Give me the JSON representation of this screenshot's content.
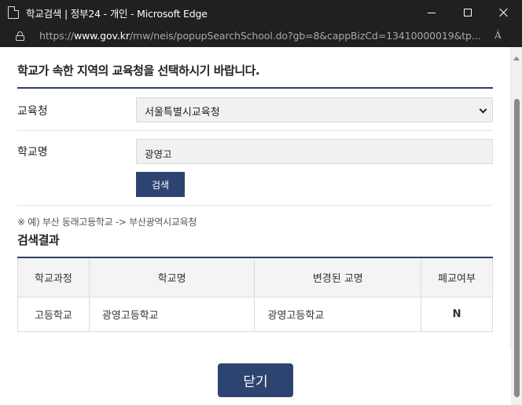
{
  "window": {
    "title": "학교검색 | 정부24 - 개인 - Microsoft Edge"
  },
  "address": {
    "prefix": "https://",
    "domain": "www.gov.kr",
    "path": "/mw/neis/popupSearchSchool.do?gb=8&cappBizCd=13410000019&tp...",
    "read_aloud": "Á"
  },
  "form": {
    "instruction": "학교가 속한 지역의 교육청을 선택하시기 바랍니다.",
    "office_label": "교육청",
    "office_value": "서울특별시교육청",
    "school_label": "학교명",
    "school_value": "광영고",
    "search_button": "검색",
    "example": "※ 예) 부산 동래고등학교 -> 부산광역시교육청"
  },
  "results": {
    "title": "검색결과",
    "headers": [
      "학교과정",
      "학교명",
      "변경된 교명",
      "폐교여부"
    ],
    "rows": [
      [
        "고등학교",
        "광영고등학교",
        "광영고등학교",
        "N"
      ]
    ]
  },
  "footer": {
    "close_button": "닫기"
  }
}
